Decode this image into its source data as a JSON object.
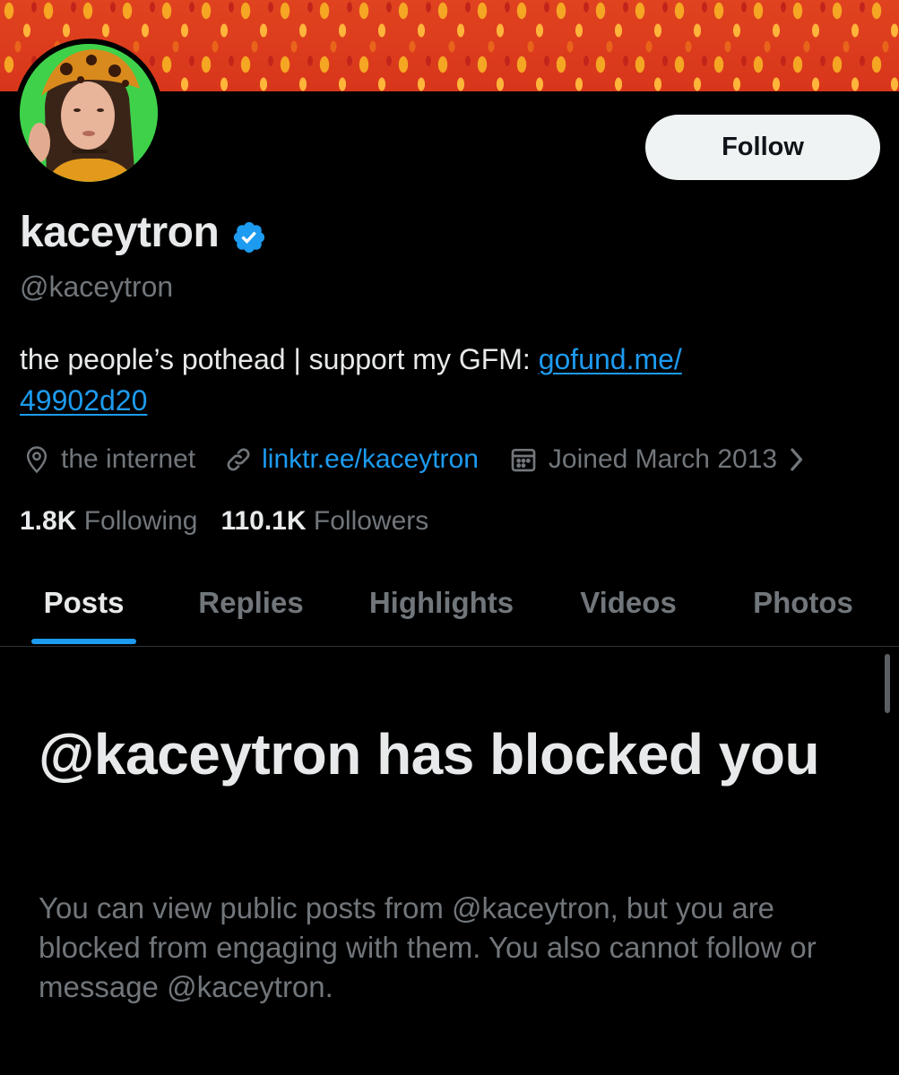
{
  "profile": {
    "display_name": "kaceytron",
    "handle": "@kaceytron",
    "verified": true,
    "follow_label": "Follow",
    "bio_text": "the people’s pothead | support my GFM: ",
    "bio_link_part1": "gofund.me/",
    "bio_link_part2": "49902d20",
    "location": "the internet",
    "website": "linktr.ee/kaceytron",
    "joined": "Joined March 2013",
    "following_count": "1.8K",
    "following_label": "Following",
    "followers_count": "110.1K",
    "followers_label": "Followers"
  },
  "tabs": [
    {
      "label": "Posts",
      "active": true
    },
    {
      "label": "Replies",
      "active": false
    },
    {
      "label": "Highlights",
      "active": false
    },
    {
      "label": "Videos",
      "active": false
    },
    {
      "label": "Photos",
      "active": false
    }
  ],
  "blocked": {
    "title": "@kaceytron has blocked you",
    "description": "You can view public posts from @kaceytron, but you are blocked from engaging with them. You also cannot follow or message @kaceytron."
  },
  "colors": {
    "background": "#000000",
    "text_primary": "#e7e9ea",
    "text_secondary": "#71767b",
    "accent": "#1d9bf0",
    "follow_button_bg": "#eff3f4"
  },
  "icons": {
    "verified": "verified-badge-icon",
    "location": "location-pin-icon",
    "link": "link-icon",
    "calendar": "calendar-icon",
    "chevron": "chevron-right-icon"
  }
}
